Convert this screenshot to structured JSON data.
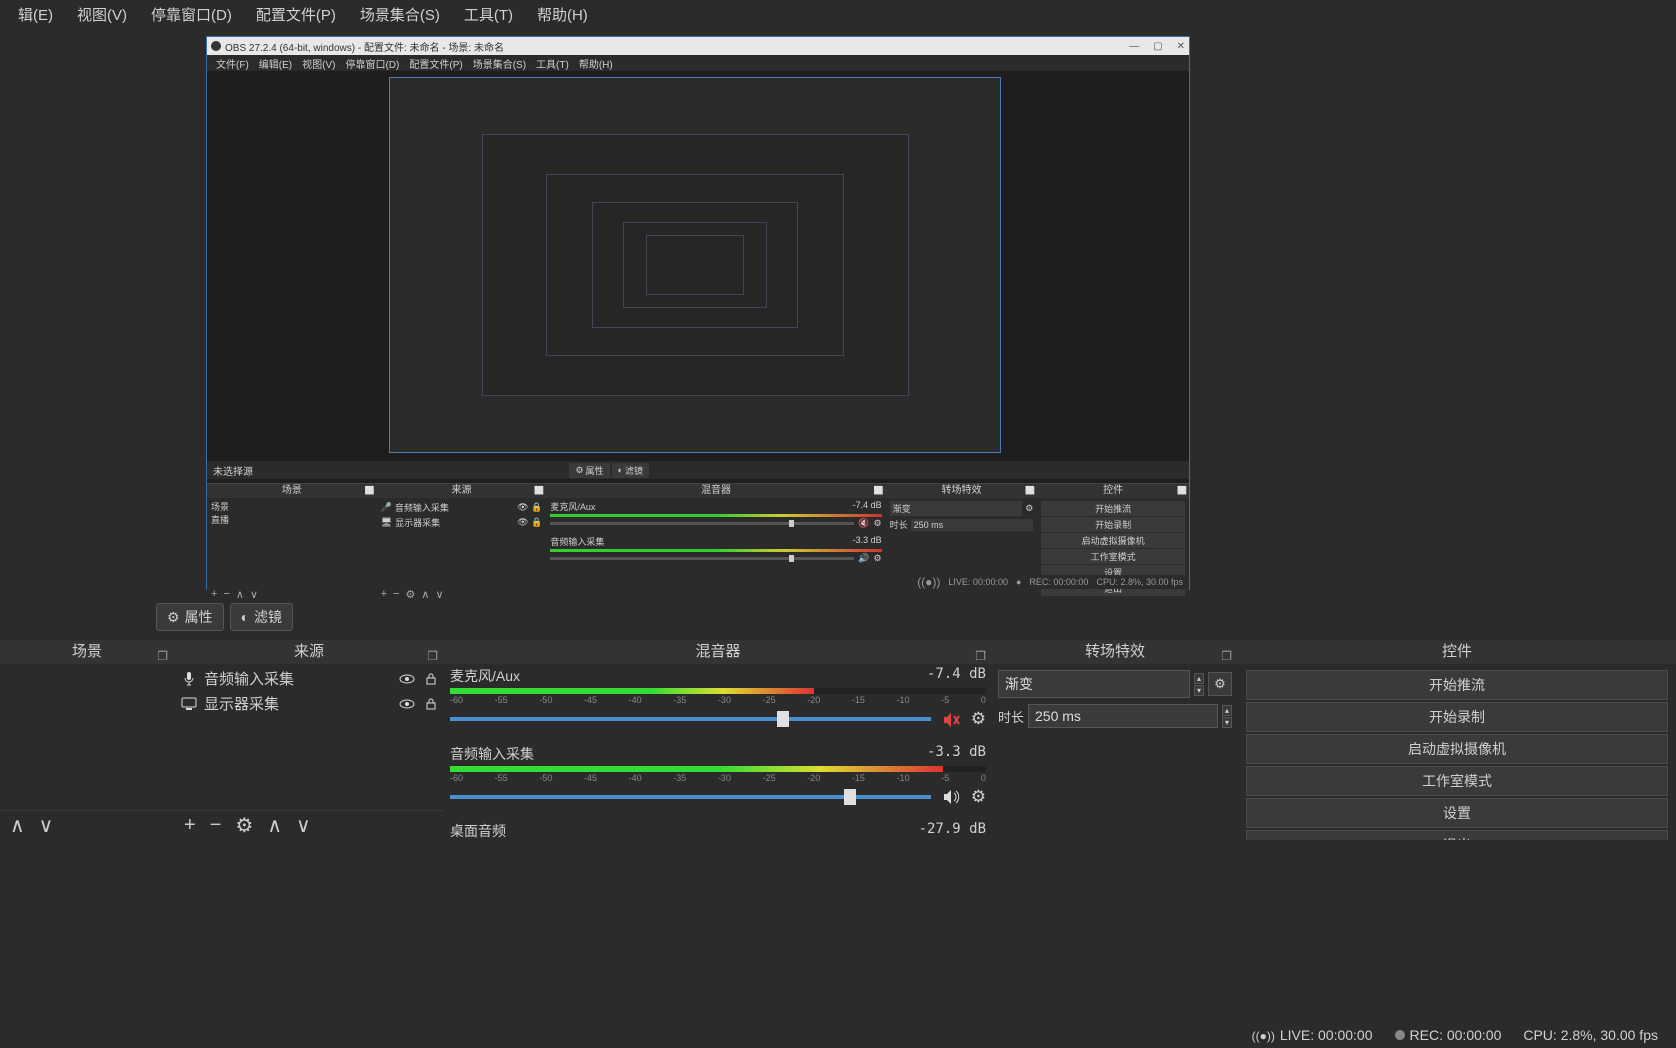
{
  "top_menu": {
    "edit": "辑(E)",
    "view": "视图(V)",
    "dock": "停靠窗口(D)",
    "profile": "配置文件(P)",
    "scene_col": "场景集合(S)",
    "tools": "工具(T)",
    "help": "帮助(H)"
  },
  "inner_window": {
    "title": "OBS 27.2.4 (64-bit, windows) - 配置文件: 未命名 - 场景: 未命名",
    "menu": {
      "file": "文件(F)",
      "edit": "编辑(E)",
      "view": "视图(V)",
      "dock": "停靠窗口(D)",
      "profile": "配置文件(P)",
      "scene_col": "场景集合(S)",
      "tools": "工具(T)",
      "help": "帮助(H)"
    }
  },
  "src_toolbar": {
    "unselected": "未选择源",
    "props": "属性",
    "filters": "滤镜"
  },
  "docks": {
    "scenes": {
      "title": "场景",
      "item1": "场景",
      "item2": "直播"
    },
    "sources": {
      "title": "来源",
      "item1": "音频输入采集",
      "item2": "显示器采集"
    },
    "mixer": {
      "title": "混音器",
      "ch1": {
        "name": "麦克风/Aux",
        "db": "-7.4 dB"
      },
      "ch2": {
        "name": "音频输入采集",
        "db": "-3.3 dB"
      },
      "ch3": {
        "name": "桌面音频",
        "db": "-27.9 dB"
      },
      "ticks": [
        "-60",
        "-55",
        "-50",
        "-45",
        "-40",
        "-35",
        "-30",
        "-25",
        "-20",
        "-15",
        "-10",
        "-5",
        "0"
      ]
    },
    "trans": {
      "title": "转场特效",
      "type": "渐变",
      "dur_label": "时长",
      "dur_value": "250 ms"
    },
    "controls": {
      "title": "控件",
      "b1": "开始推流",
      "b2": "开始录制",
      "b3": "启动虚拟摄像机",
      "b4": "工作室模式",
      "b5": "设置",
      "b6": "退出"
    }
  },
  "inner_docks": {
    "mixer_ch1_name": "麦克风/Aux",
    "mixer_ch1_db": "-7.4 dB",
    "mixer_ch2_name": "音频输入采集",
    "mixer_ch2_db": "-3.3 dB"
  },
  "status": {
    "live_label": "LIVE: 00:00:00",
    "rec_label": "REC: 00:00:00",
    "cpu": "CPU: 2.8%, 30.00 fps"
  },
  "inner_status": {
    "live": "LIVE: 00:00:00",
    "rec": "REC: 00:00:00",
    "cpu": "CPU: 2.8%, 30.00 fps"
  }
}
